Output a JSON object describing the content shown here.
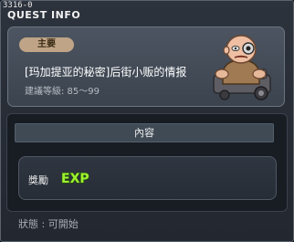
{
  "window": {
    "quest_id": "3316-0",
    "title": "QUEST INFO"
  },
  "quest": {
    "category_badge": "主要",
    "name": "[玛加提亚的秘密]后街小贩的情报",
    "level_label": "建議等級: 85～99"
  },
  "npc": {
    "icon": "elderly-npc-portrait"
  },
  "content": {
    "header": "內容",
    "reward_label": "獎勵",
    "reward_icon_text": "EXP"
  },
  "status": {
    "text": "狀態 : 可開始"
  },
  "colors": {
    "badge_bg": "#bfa487",
    "exp_green": "#9df22f"
  }
}
